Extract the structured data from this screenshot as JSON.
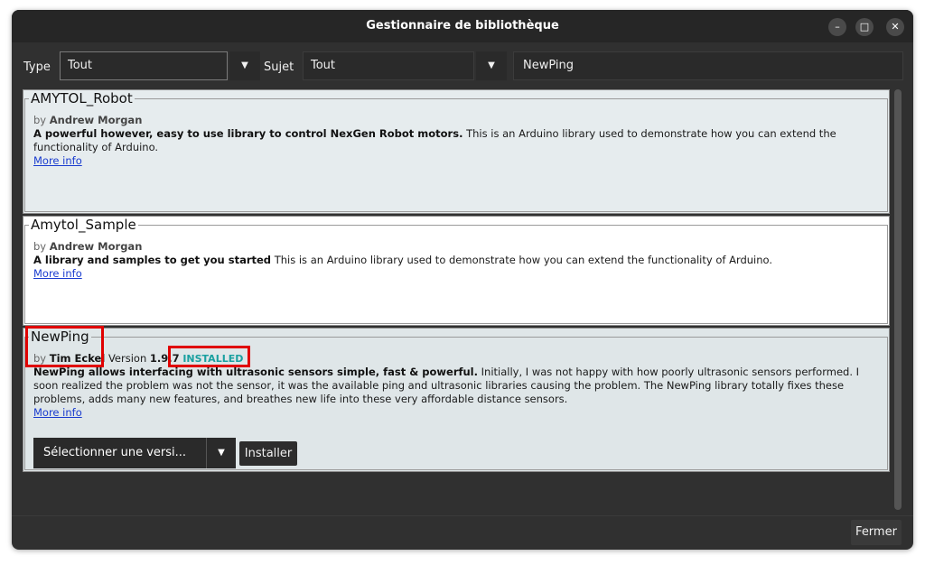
{
  "window": {
    "title": "Gestionnaire de bibliothèque",
    "controls": {
      "minimize": "–",
      "maximize": "□",
      "close": "✕"
    }
  },
  "filters": {
    "type_label": "Type",
    "type_value": "Tout",
    "subject_label": "Sujet",
    "subject_value": "Tout",
    "dropdown_icon": "▼",
    "search_value": "NewPing"
  },
  "libraries": [
    {
      "name": "AMYTOL_Robot",
      "by": "by",
      "author": "Andrew Morgan",
      "desc_bold": "A powerful however, easy to use library to control NexGen Robot motors.",
      "desc": " This is an Arduino library used to demonstrate how you can extend the functionality of Arduino.",
      "more_info": "More info"
    },
    {
      "name": "Amytol_Sample",
      "by": "by",
      "author": "Andrew Morgan",
      "desc_bold": "A library and samples to get you started",
      "desc": " This is an Arduino library used to demonstrate how you can extend the functionality of Arduino.",
      "more_info": "More info"
    },
    {
      "name": "NewPing",
      "by": "by",
      "author": "Tim Eckel",
      "version_label": "Version",
      "version": "1.9.7",
      "status": "INSTALLED",
      "desc_bold": "NewPing allows interfacing with ultrasonic sensors simple, fast & powerful.",
      "desc": " Initially, I was not happy with how poorly ultrasonic sensors performed. I soon realized the problem was not the sensor, it was the available ping and ultrasonic libraries causing the problem. The NewPing library totally fixes these problems, adds many new features, and breathes new life into these very affordable distance sensors.",
      "more_info": "More info",
      "version_select": "Sélectionner une versi...",
      "install_button": "Installer"
    }
  ],
  "footer": {
    "close_button": "Fermer"
  },
  "colors": {
    "window_bg": "#303030",
    "card_light": "#ffffff",
    "card_tint": "#e6ecee",
    "highlight": "#e00000",
    "installed": "#1aa0a0",
    "link": "#1a3ccf"
  }
}
